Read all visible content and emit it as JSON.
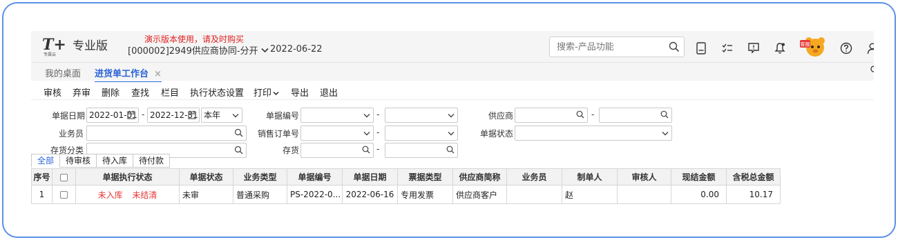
{
  "header": {
    "logo_mark": "T+",
    "logo_sub": "专属云",
    "product": "专业版",
    "demo_notice": "演示版本使用，请及时购买",
    "company": "[000002]2949供应商协同-分开",
    "date": "2022-06-22",
    "search_placeholder": "搜索-产品功能",
    "mascot_label": "客服",
    "icons": [
      "calculator-icon",
      "checklist-icon",
      "message-icon",
      "bell-icon",
      "customer-service-mascot",
      "help-icon",
      "user-icon"
    ]
  },
  "tabs": [
    {
      "label": "我的桌面",
      "active": false
    },
    {
      "label": "进货单工作台",
      "active": true,
      "closable": true
    }
  ],
  "tab_close": "×",
  "toolbar": [
    "审核",
    "弃审",
    "删除",
    "查找",
    "栏目",
    "执行状态设置",
    "打印",
    "导出",
    "退出"
  ],
  "filters": {
    "doc_date_label": "单据日期",
    "date_from": "2022-01-01",
    "date_to": "2022-12-31",
    "dash": "-",
    "period": "本年",
    "doc_no_label": "单据编号",
    "supplier_label": "供应商",
    "salesman_label": "业务员",
    "sales_order_label": "销售订单号",
    "doc_status_label": "单据状态",
    "inventory_category_label": "存货分类",
    "inventory_label": "存货"
  },
  "status_tabs": [
    "全部",
    "待审核",
    "待入库",
    "待付款"
  ],
  "grid": {
    "columns": [
      "序号",
      "",
      "单据执行状态",
      "单据状态",
      "业务类型",
      "单据编号",
      "单据日期",
      "票据类型",
      "供应商简称",
      "业务员",
      "制单人",
      "审核人",
      "现结金额",
      "含税总金额"
    ],
    "rows": [
      {
        "seq": "1",
        "exec_status_1": "未入库",
        "exec_status_2": "未结清",
        "doc_status": "未审",
        "biz_type": "普通采购",
        "doc_no": "PS-2022-0...",
        "doc_date": "2022-06-16",
        "invoice_type": "专用发票",
        "supplier": "供应商客户",
        "salesman": "",
        "maker": "赵",
        "auditor": "",
        "cash_amount": "0.00",
        "total_amount": "10.17"
      }
    ]
  },
  "colors": {
    "accent": "#2a62d8",
    "alert": "#e53935",
    "frame": "#5b8fe6"
  }
}
